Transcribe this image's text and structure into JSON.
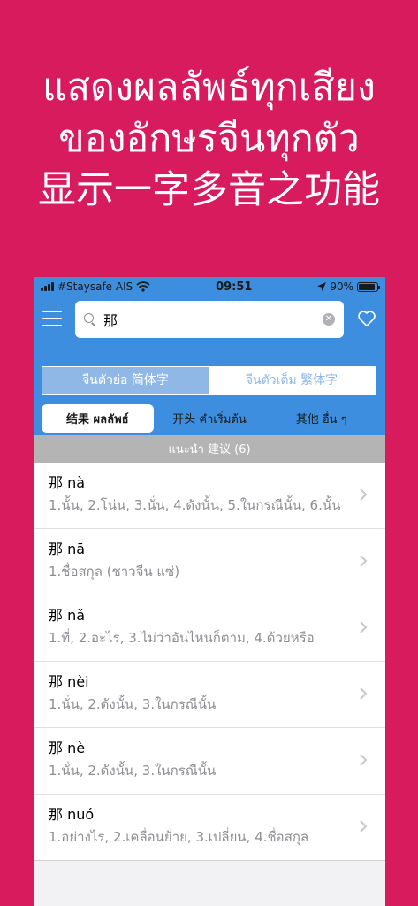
{
  "promo": {
    "line1": "แสดงผลลัพธ์ทุกเสียง",
    "line2": "ของอักษรจีนทุกตัว",
    "line3": "显示一字多音之功能"
  },
  "statusbar": {
    "carrier": "#Staysafe AIS",
    "time": "09:51",
    "battery": "90%",
    "battery_level": 0.9
  },
  "search": {
    "value": "那"
  },
  "script_toggle": {
    "simplified": "จีนตัวย่อ 简体字",
    "traditional": "จีนตัวเต็ม 繁体字"
  },
  "mode_tabs": {
    "results": "结果 ผลลัพธ์",
    "starts": "开头 คำเริ่มต้น",
    "other": "其他  อื่น ๆ"
  },
  "section": {
    "header": "แนะนำ 建议 (6)"
  },
  "results": [
    {
      "title": "那 nà",
      "meaning": "1.นั้น, 2.โน่น, 3.นั่น, 4.ดังนั้น, 5.ในกรณีนั้น, 6.นั้น"
    },
    {
      "title": "那 nā",
      "meaning": "1.ชื่อสกุล (ชาวจีน แซ่)"
    },
    {
      "title": "那 nǎ",
      "meaning": "1.ที่, 2.อะไร, 3.ไม่ว่าอันไหนก็ตาม, 4.ด้วยหรือ"
    },
    {
      "title": "那 nèi",
      "meaning": "1.นั่น, 2.ดังนั้น, 3.ในกรณีนั้น"
    },
    {
      "title": "那 nè",
      "meaning": "1.นั่น, 2.ดังนั้น, 3.ในกรณีนั้น"
    },
    {
      "title": "那 nuó",
      "meaning": "1.อย่างไร, 2.เคลื่อนย้าย, 3.เปลี่ยน, 4.ชื่อสกุล"
    }
  ],
  "colors": {
    "background": "#d81b5d",
    "bar": "#3d8ede",
    "segment_selected": "#8fb8e6"
  }
}
